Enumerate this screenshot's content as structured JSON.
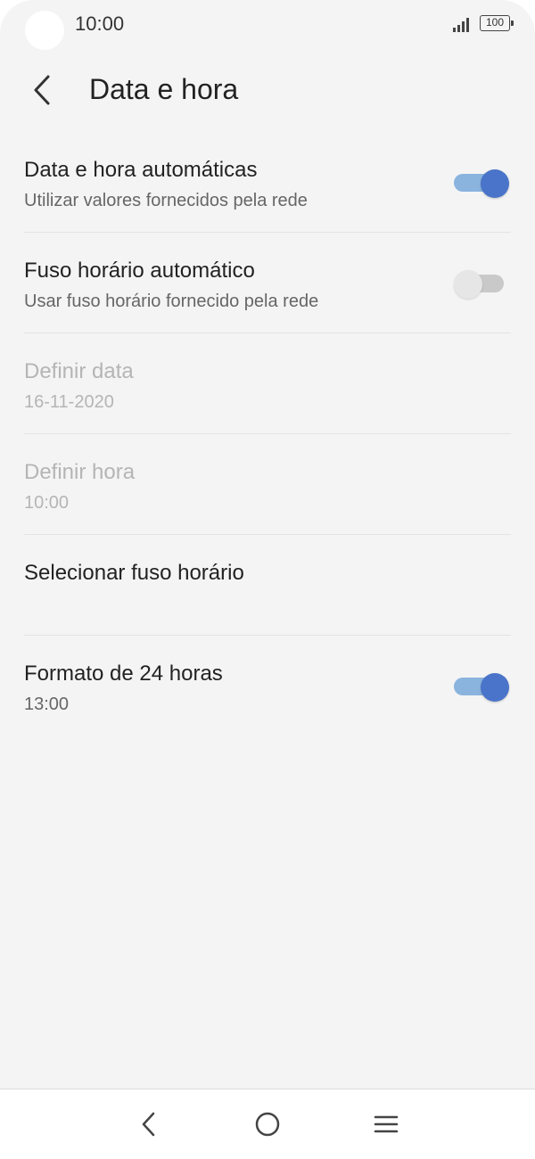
{
  "status_bar": {
    "time": "10:00",
    "battery": "100",
    "icons": [
      "signal-icon",
      "battery-icon"
    ]
  },
  "header": {
    "title": "Data e hora",
    "back_icon": "back-arrow-icon"
  },
  "settings": {
    "items": [
      {
        "title": "Data e hora automáticas",
        "subtitle": "Utilizar valores fornecidos pela rede",
        "toggle": "on"
      },
      {
        "title": "Fuso horário automático",
        "subtitle": "Usar fuso horário fornecido pela rede",
        "toggle": "off"
      },
      {
        "title": "Definir data",
        "subtitle": "16-11-2020",
        "disabled": true
      },
      {
        "title": "Definir hora",
        "subtitle": "10:00",
        "disabled": true
      },
      {
        "title": "Selecionar fuso horário"
      },
      {
        "title": "Formato de 24 horas",
        "subtitle": "13:00",
        "toggle": "on"
      }
    ]
  },
  "nav_bar": {
    "icons": [
      "back-icon",
      "home-icon",
      "menu-icon"
    ]
  },
  "colors": {
    "accent": "#4a74c9",
    "accent_track": "#8ab3de",
    "background": "#f4f4f4",
    "disabled_text": "#b5b5b5"
  }
}
